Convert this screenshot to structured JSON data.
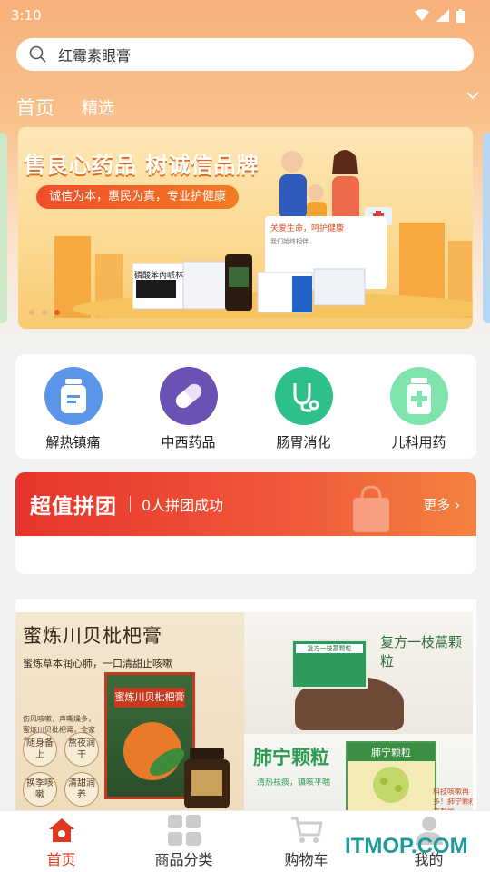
{
  "status": {
    "time": "3:10"
  },
  "search": {
    "value": "红霉素眼膏"
  },
  "tabs": {
    "home": "首页",
    "featured": "精选"
  },
  "banner": {
    "title": "售良心药品 树诚信品牌",
    "subtitle": "诚信为本，惠民为真，专业护健康",
    "card_title": "关爱生命，呵护健康",
    "card_sub": "我们始终相伴",
    "product_label": "磷酸苯丙哌林"
  },
  "categories": [
    {
      "label": "解热镇痛",
      "color": "#5b95ea"
    },
    {
      "label": "中西药品",
      "color": "#6a52b4"
    },
    {
      "label": "肠胃消化",
      "color": "#2dc08a"
    },
    {
      "label": "儿科用药",
      "color": "#7ee3ad"
    }
  ],
  "group_buy": {
    "title": "超值拼团",
    "status": "0人拼团成功",
    "more": "更多"
  },
  "promo": {
    "left_title": "蜜炼川贝枇杷膏",
    "left_sub": "蜜炼草本润心肺，一口清甜止咳嗽",
    "left_small": "伤风咳嗽，声嘶燥多，蜜炼川贝枇杷膏，全家安心用",
    "seals": [
      "随身备上",
      "熬夜润干",
      "换季咳嗽",
      "清甜润养"
    ],
    "left_box_label": "蜜炼川贝枇杷膏",
    "rt_title": "复方一枝蒿颗粒",
    "rt_box_label": "复方一枝蒿颗粒",
    "rb_title": "肺宁颗粒",
    "rb_sub": "清热祛痰，镇咳平喘",
    "rb_box_label": "肺宁颗粒",
    "rb_note": "科技咳嗽再多！肺宁颗粒来帮忙"
  },
  "nav": [
    {
      "label": "首页",
      "active": true
    },
    {
      "label": "商品分类",
      "active": false
    },
    {
      "label": "购物车",
      "active": false
    },
    {
      "label": "我的",
      "active": false
    }
  ],
  "watermark": "ITMOP.COM",
  "colors": {
    "accent": "#e0381f",
    "orange": "#f27b22"
  }
}
